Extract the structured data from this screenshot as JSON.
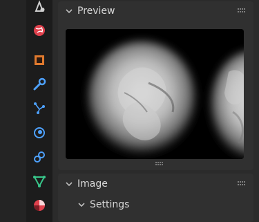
{
  "sidebar": {
    "tabs": [
      {
        "icon": "render-icon"
      },
      {
        "icon": "world-icon"
      },
      {
        "icon": "object-icon"
      },
      {
        "icon": "modifier-wrench-icon"
      },
      {
        "icon": "particles-icon"
      },
      {
        "icon": "physics-icon"
      },
      {
        "icon": "constraints-icon"
      },
      {
        "icon": "object-data-icon"
      },
      {
        "icon": "material-icon"
      }
    ]
  },
  "panels": {
    "preview": {
      "title": "Preview",
      "expanded": true
    },
    "image": {
      "title": "Image",
      "expanded": true
    },
    "settings": {
      "title": "Settings",
      "expanded": true
    }
  },
  "colors": {
    "orange": "#e07a2e",
    "blue": "#4ea2ff",
    "green": "#38c68a",
    "red": "#e0414d"
  }
}
